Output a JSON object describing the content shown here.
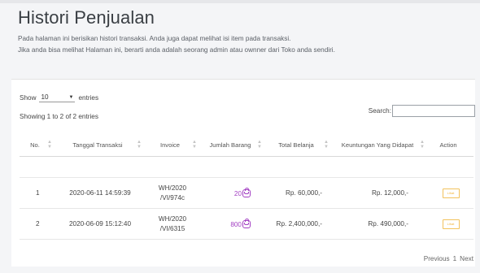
{
  "page": {
    "title": "Histori Penjualan",
    "description_line1": "Pada halaman ini berisikan histori transaksi. Anda juga dapat melihat isi item pada transaksi.",
    "description_line2": "Jika anda bisa melihat Halaman ini, berarti anda adalah seorang admin atau ownner dari Toko anda sendiri."
  },
  "controls": {
    "show_label": "Show",
    "entries_value": "10",
    "entries_label": "entries",
    "info": "Showing 1 to 2 of 2 entries",
    "search_label": "Search:",
    "search_value": ""
  },
  "table": {
    "headers": [
      "No.",
      "Tanggal Transaksi",
      "Invoice",
      "Jumlah Barang",
      "Total Belanja",
      "Keuntungan Yang Didapat",
      "Action"
    ],
    "rows": [
      {
        "no": "1",
        "date": "2020-06-11 14:59:39",
        "invoice_l1": "WH/2020",
        "invoice_l2": "/VI/974c",
        "qty": "20",
        "total": "Rp. 60,000,-",
        "profit": "Rp. 12,000,-",
        "action": "Lihat"
      },
      {
        "no": "2",
        "date": "2020-06-09 15:12:40",
        "invoice_l1": "WH/2020",
        "invoice_l2": "/VI/6315",
        "qty": "800",
        "total": "Rp. 2,400,000,-",
        "profit": "Rp. 490,000,-",
        "action": "Lihat"
      }
    ]
  },
  "pagination": {
    "previous": "Previous",
    "current": "1",
    "next": "Next"
  },
  "colors": {
    "accent_purple": "#a23ec2",
    "action_amber": "#f2b53c"
  }
}
